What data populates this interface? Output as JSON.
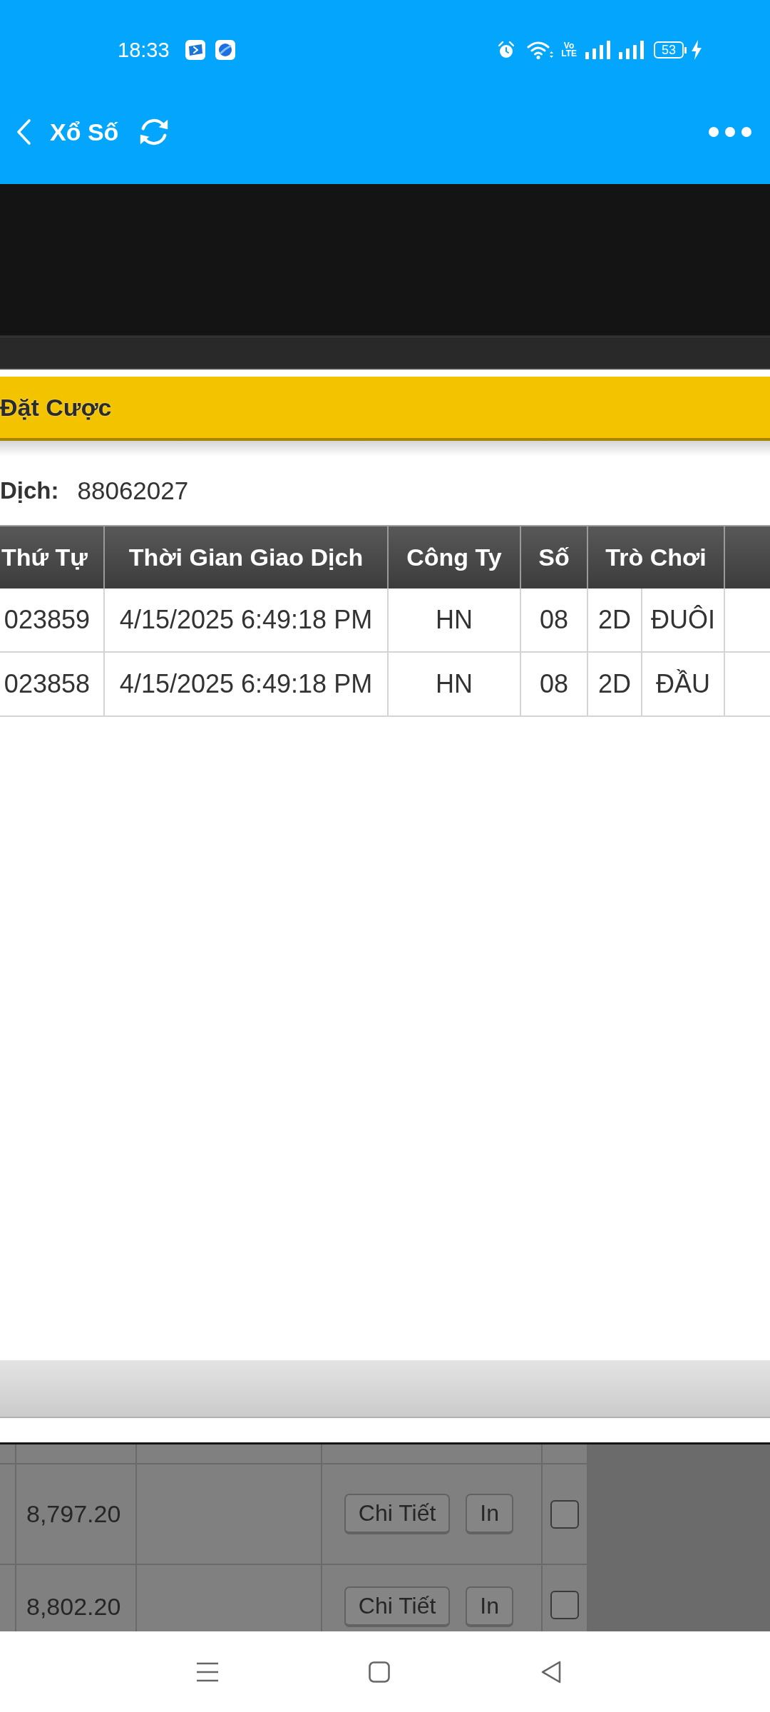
{
  "status_bar": {
    "time": "18:33",
    "network_lines": [
      "Vo",
      "LTE"
    ],
    "battery": "53"
  },
  "app_bar": {
    "title": "Xổ Số"
  },
  "bet_panel": {
    "title": "Đặt Cược",
    "transaction": {
      "label": "Dịch:",
      "value": "88062027"
    },
    "table": {
      "columns": [
        "Thứ Tự",
        "Thời Gian Giao Dịch",
        "Công Ty",
        "Số",
        "Trò Chơi"
      ],
      "rows": [
        {
          "order": "023859",
          "time": "4/15/2025 6:49:18 PM",
          "company": "HN",
          "number": "08",
          "game_type": "2D",
          "game_name": "ĐUÔI"
        },
        {
          "order": "023858",
          "time": "4/15/2025 6:49:18 PM",
          "company": "HN",
          "number": "08",
          "game_type": "2D",
          "game_name": "ĐẦU"
        }
      ]
    }
  },
  "background_table": {
    "rows": [
      {
        "column_2": "8,797.20",
        "buttons": [
          "Chi Tiết",
          "In"
        ],
        "checked": false
      },
      {
        "column_2": "8,802.20",
        "buttons": [
          "Chi Tiết",
          "In"
        ],
        "checked": false
      }
    ]
  }
}
